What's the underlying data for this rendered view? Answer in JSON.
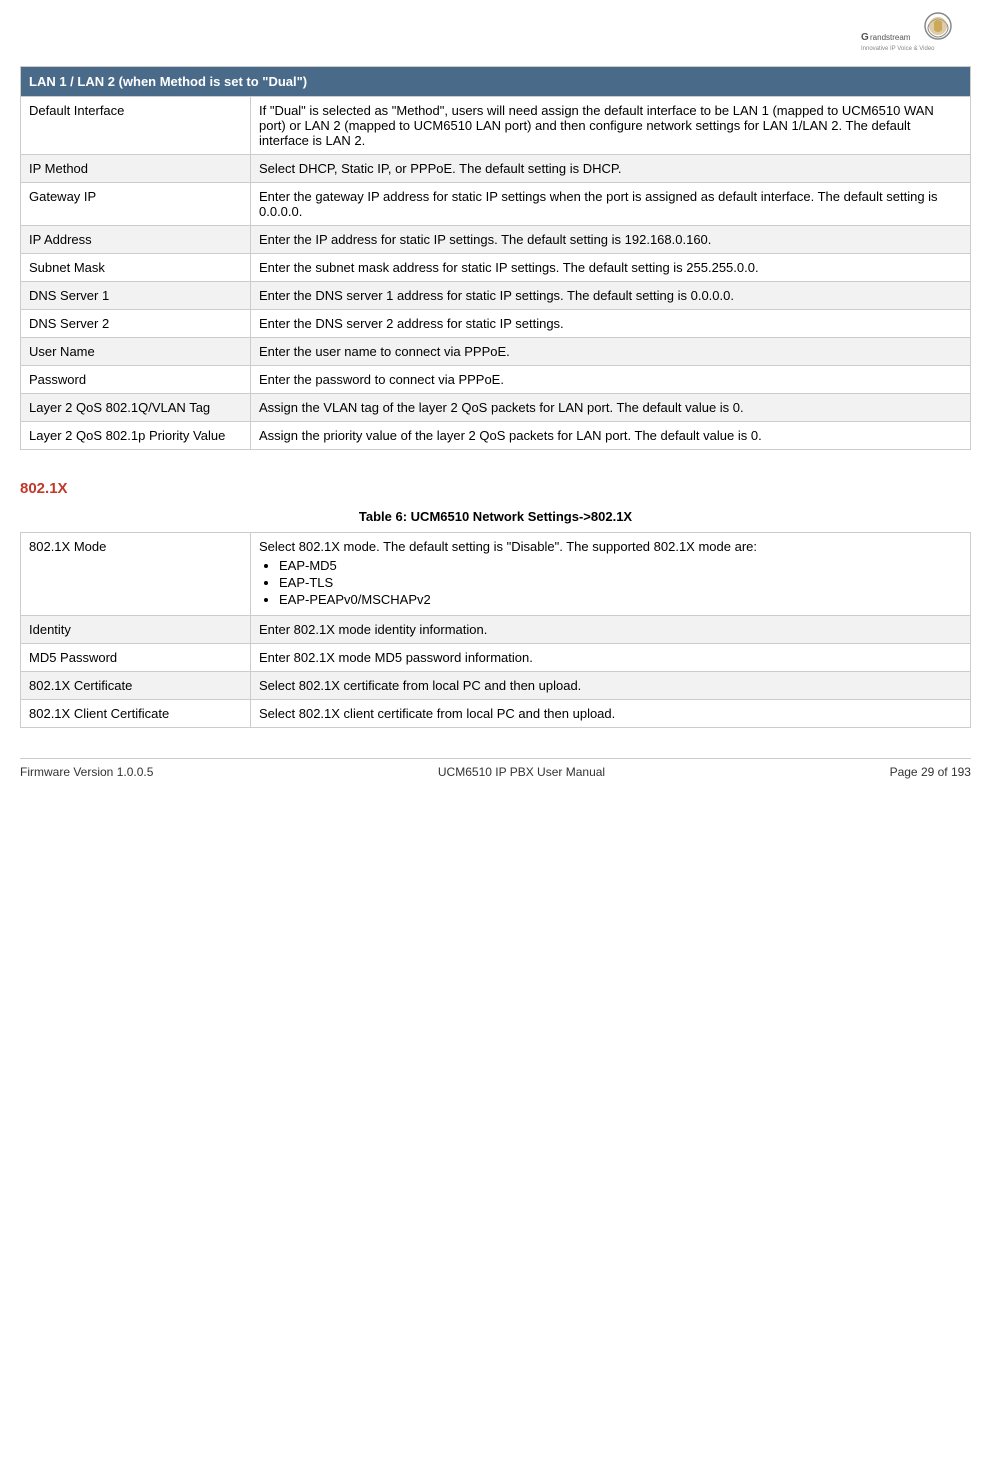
{
  "logo": {
    "alt": "Grandstream Logo"
  },
  "main_section": {
    "header": "LAN 1 / LAN 2 (when Method is set to \"Dual\")",
    "rows": [
      {
        "label": "Default Interface",
        "desc": "If \"Dual\" is selected as \"Method\", users will need assign the default interface to be LAN 1 (mapped to UCM6510 WAN port) or LAN 2 (mapped to UCM6510 LAN port) and then configure network settings for LAN 1/LAN 2. The default interface is LAN 2.",
        "alt": false
      },
      {
        "label": "IP Method",
        "desc": "Select DHCP, Static IP, or PPPoE. The default setting is DHCP.",
        "alt": true
      },
      {
        "label": "Gateway IP",
        "desc": "Enter the gateway IP address for static IP settings when the port is assigned as default interface. The default setting is 0.0.0.0.",
        "alt": false
      },
      {
        "label": "IP Address",
        "desc": "Enter the IP address for static IP settings. The default setting is 192.168.0.160.",
        "alt": true
      },
      {
        "label": "Subnet Mask",
        "desc": "Enter  the  subnet  mask  address  for  static  IP  settings.  The  default  setting  is 255.255.0.0.",
        "alt": false
      },
      {
        "label": "DNS Server 1",
        "desc": "Enter  the  DNS  server  1  address  for  static  IP  settings.  The  default  setting  is 0.0.0.0.",
        "alt": true
      },
      {
        "label": "DNS Server 2",
        "desc": "Enter the DNS server 2 address for static IP settings.",
        "alt": false
      },
      {
        "label": "User Name",
        "desc": "Enter the user name to connect via PPPoE.",
        "alt": true
      },
      {
        "label": "Password",
        "desc": "Enter the password to connect via PPPoE.",
        "alt": false
      },
      {
        "label": "Layer 2 QoS 802.1Q/VLAN Tag",
        "desc": "Assign the VLAN tag of the layer 2 QoS packets for LAN port. The default value is 0.",
        "alt": true
      },
      {
        "label": "Layer 2 QoS 802.1p Priority Value",
        "desc": "Assign the priority value of the layer 2 QoS packets for LAN port. The default value is 0.",
        "alt": false
      }
    ]
  },
  "section_802": {
    "title": "802.1X",
    "table_caption": "Table 6: UCM6510 Network Settings->802.1X",
    "rows": [
      {
        "label": "802.1X Mode",
        "desc_intro": "Select  802.1X  mode.  The  default  setting  is  \"Disable\".  The  supported  802.1X mode are:",
        "bullets": [
          "EAP-MD5",
          "EAP-TLS",
          "EAP-PEAPv0/MSCHAPv2"
        ],
        "alt": false
      },
      {
        "label": "Identity",
        "desc": "Enter 802.1X mode identity information.",
        "alt": true
      },
      {
        "label": "MD5 Password",
        "desc": "Enter 802.1X mode MD5 password information.",
        "alt": false
      },
      {
        "label": "802.1X Certificate",
        "desc": "Select 802.1X certificate from local PC and then upload.",
        "alt": true
      },
      {
        "label": "802.1X Client Certificate",
        "desc": "Select 802.1X client certificate from local PC and then upload.",
        "alt": false
      }
    ]
  },
  "footer": {
    "firmware": "Firmware Version 1.0.0.5",
    "manual": "UCM6510 IP PBX User Manual",
    "page": "Page 29 of 193"
  }
}
